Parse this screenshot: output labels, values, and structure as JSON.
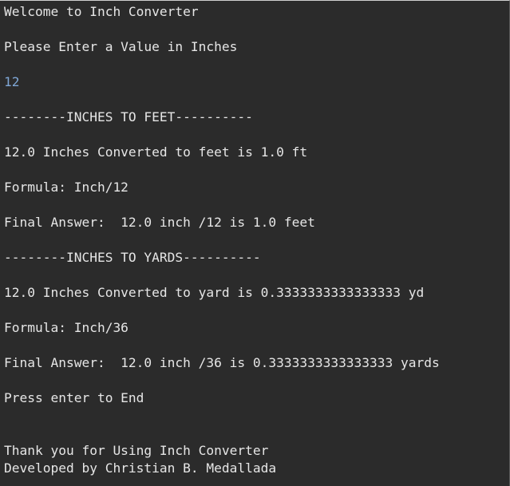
{
  "console": {
    "lines": [
      {
        "text": "Welcome to Inch Converter",
        "kind": "output"
      },
      {
        "text": "Please Enter a Value in Inches",
        "kind": "output"
      },
      {
        "text": "12",
        "kind": "input"
      },
      {
        "text": "--------INCHES TO FEET----------",
        "kind": "output"
      },
      {
        "text": "12.0 Inches Converted to feet is 1.0 ft",
        "kind": "output"
      },
      {
        "text": "Formula: Inch/12",
        "kind": "output"
      },
      {
        "text": "Final Answer:  12.0 inch /12 is 1.0 feet",
        "kind": "output"
      },
      {
        "text": "--------INCHES TO YARDS----------",
        "kind": "output"
      },
      {
        "text": "12.0 Inches Converted to yard is 0.3333333333333333 yd",
        "kind": "output"
      },
      {
        "text": "Formula: Inch/36",
        "kind": "output"
      },
      {
        "text": "Final Answer:  12.0 inch /36 is 0.3333333333333333 yards",
        "kind": "output"
      },
      {
        "text": "Press enter to End",
        "kind": "output"
      },
      {
        "text": "Thank you for Using Inch Converter",
        "kind": "output"
      },
      {
        "text": "Developed by Christian B. Medallada",
        "kind": "output"
      }
    ]
  },
  "colors": {
    "background": "#2b2b2b",
    "output_text": "#e6e6e6",
    "input_text": "#7fa7d6"
  }
}
